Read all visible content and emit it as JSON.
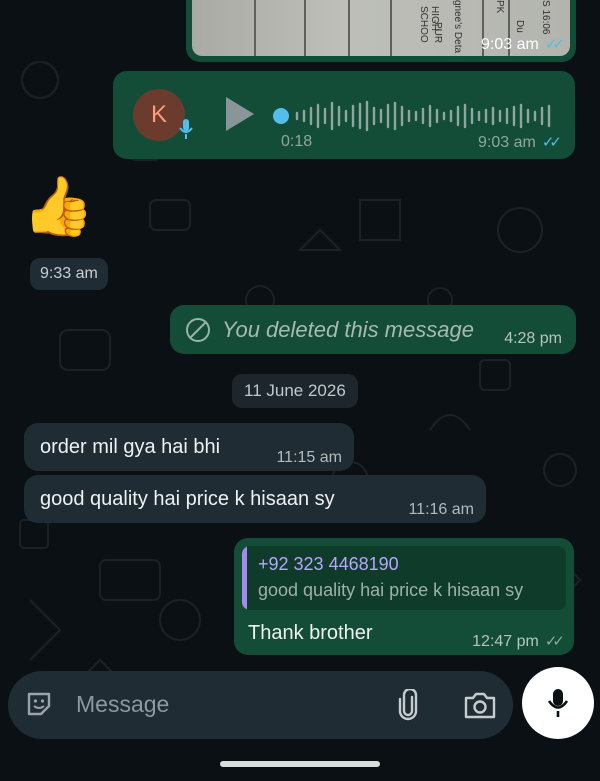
{
  "image_message": {
    "time": "9:03 am",
    "photo_text_1": "HIGH SCHOO",
    "photo_text_2": "PUR",
    "photo_text_3": "gnee's Deta",
    "photo_text_4": "PK",
    "photo_text_5": "Du",
    "photo_text_6": "S 16:06",
    "ticks_icon": "read-double-check-icon"
  },
  "voice_message": {
    "avatar_letter": "K",
    "duration": "0:18",
    "time": "9:03 am",
    "progress": 0.0,
    "ticks_icon": "read-double-check-icon"
  },
  "emoji_message": {
    "emoji": "👍",
    "time": "9:33 am"
  },
  "deleted_message": {
    "text": "You deleted this message",
    "time": "4:28 pm"
  },
  "date_chip": "11 June 2026",
  "incoming": [
    {
      "text": "order mil gya hai bhi",
      "time": "11:15 am"
    },
    {
      "text": "good quality hai price k hisaan sy",
      "time": "11:16 am"
    }
  ],
  "reply_message": {
    "quoted_sender": "+92 323 4468190",
    "quoted_text": "good quality hai price k hisaan sy",
    "text": "Thank brother",
    "time": "12:47 pm",
    "ticks_icon": "delivered-double-check-icon"
  },
  "composer": {
    "placeholder": "Message"
  },
  "colors": {
    "background": "#0b1014",
    "outgoing_bubble": "#144d37",
    "incoming_bubble": "#202c33",
    "read_ticks": "#53bdeb",
    "quote_accent": "#a48af1"
  }
}
